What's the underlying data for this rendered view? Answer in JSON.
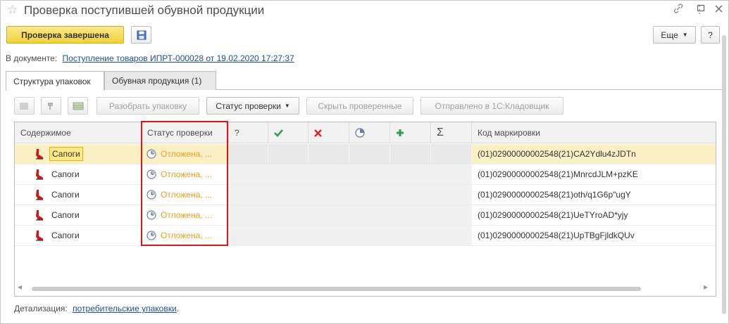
{
  "window": {
    "title": "Проверка поступившей обувной продукции",
    "link_icon": "link-icon",
    "maximize_icon": "maximize-icon",
    "close_icon": "close-icon"
  },
  "toolbar": {
    "complete_label": "Проверка завершена",
    "more_label": "Еще",
    "help_label": "?"
  },
  "document": {
    "prefix": "В документе:",
    "link": "Поступление товаров ИПРТ-000028 от 19.02.2020 17:27:37"
  },
  "tabs": [
    {
      "label": "Структура упаковок",
      "active": true
    },
    {
      "label": "Обувная продукция (1)",
      "active": false
    }
  ],
  "grid_toolbar": {
    "unpack_label": "Разобрать упаковку",
    "status_label": "Статус проверки",
    "hide_checked_label": "Скрыть проверенные",
    "sent_label": "Отправлено в 1С:Кладовщик"
  },
  "columns": {
    "content": "Содержимое",
    "status": "Статус проверки",
    "unknown": "?",
    "code": "Код маркировки"
  },
  "rows": [
    {
      "name": "Сапоги",
      "status": "Отложена, ...",
      "code": "(01)02900000002548(21)CA2Ydlu4zJDTn"
    },
    {
      "name": "Сапоги",
      "status": "Отложена, ...",
      "code": "(01)02900000002548(21)MnrcdJLM+pzKE"
    },
    {
      "name": "Сапоги",
      "status": "Отложена, ...",
      "code": "(01)02900000002548(21)oth/q1G6p\"ugY"
    },
    {
      "name": "Сапоги",
      "status": "Отложена, ...",
      "code": "(01)02900000002548(21)UeTYroAD*yjy"
    },
    {
      "name": "Сапоги",
      "status": "Отложена, ...",
      "code": "(01)02900000002548(21)UpTBgFjldkQUv"
    }
  ],
  "detail": {
    "prefix": "Детализация:",
    "link": "потребительские упаковки",
    "suffix": "."
  },
  "colors": {
    "primary_button": "#f3d23a",
    "status_text": "#e6a21b",
    "highlight": "#e0141b",
    "link": "#1c4e96",
    "selected_row": "#fbf0c4"
  }
}
